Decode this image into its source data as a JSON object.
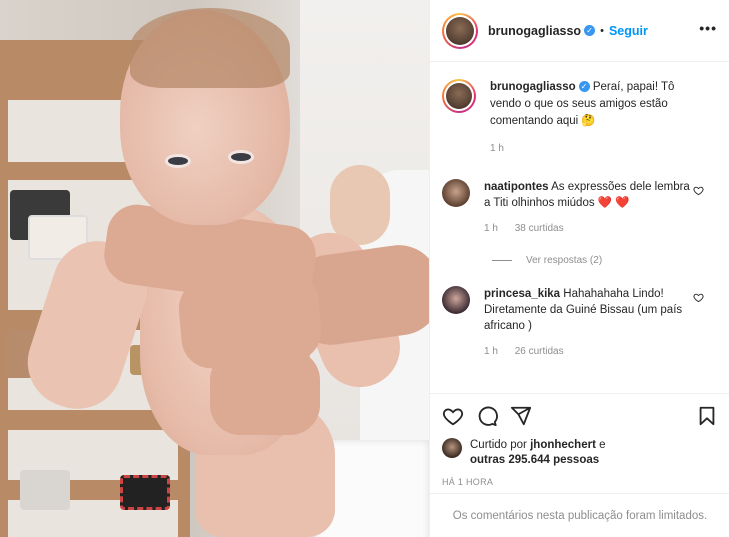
{
  "header": {
    "username": "brunogagliasso",
    "separator": "•",
    "follow_label": "Seguir",
    "more_label": "•••"
  },
  "caption": {
    "username": "brunogagliasso",
    "text": "Peraí, papai! Tô vendo o que os seus amigos estão comentando aqui 🤔",
    "time": "1 h"
  },
  "comments": [
    {
      "username": "naatipontes",
      "text": "As expressões dele lembra a Titi olhinhos miúdos ❤️ ❤️",
      "time": "1 h",
      "likes": "38 curtidas",
      "replies_label": "Ver respostas (2)"
    },
    {
      "username": "princesa_kika",
      "text": "Hahahahaha Lindo! Diretamente da Guiné Bissau (um país africano )",
      "time": "1 h",
      "likes": "26 curtidas"
    }
  ],
  "likes": {
    "prefix": "Curtido por",
    "user": "jhonhechert",
    "connector": "e",
    "others": "outras 295.644 pessoas"
  },
  "post_time": "HÁ 1 HORA",
  "comments_limited": "Os comentários nesta publicação foram limitados.",
  "icons": {
    "like": "heart-icon",
    "comment": "comment-icon",
    "share": "send-icon",
    "save": "bookmark-icon",
    "verified": "verified-badge-icon",
    "comment_like": "small-heart-icon"
  },
  "colors": {
    "accent": "#0095f6",
    "verified": "#3897f0",
    "muted": "#8e8e8e",
    "text": "#262626",
    "border": "#efefef"
  }
}
